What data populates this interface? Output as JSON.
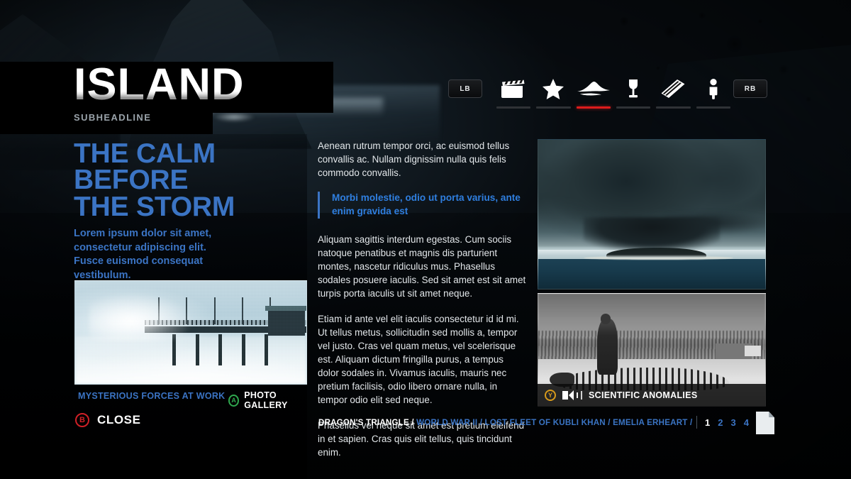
{
  "header": {
    "title": "ISLAND",
    "subheadline": "SUBHEADLINE"
  },
  "topnav": {
    "left_bumper": "LB",
    "right_bumper": "RB",
    "items": [
      {
        "label": "Movies",
        "icon": "clapperboard-icon",
        "active": false
      },
      {
        "label": "Favorites",
        "icon": "star-icon",
        "active": false
      },
      {
        "label": "Island",
        "icon": "island-icon",
        "active": true
      },
      {
        "label": "Goblet",
        "icon": "goblet-icon",
        "active": false
      },
      {
        "label": "Book",
        "icon": "book-icon",
        "active": false
      },
      {
        "label": "Character",
        "icon": "person-icon",
        "active": false
      }
    ],
    "active_indicator_color": "#dd1c1c"
  },
  "feature": {
    "kicker_line1": "THE CALM",
    "kicker_line2": "BEFORE",
    "kicker_line3": "THE STORM",
    "lede": "Lorem ipsum dolor sit amet, consectetur adipiscing elit. Fusce euismod consequat vestibulum.",
    "photo_caption": "MYSTERIOUS FORCES AT WORK",
    "gallery_button": "PHOTO GALLERY",
    "gallery_button_glyph": "A",
    "close_button": "CLOSE",
    "close_button_glyph": "B"
  },
  "article": {
    "p1": "Aenean rutrum tempor orci, ac euismod tellus convallis ac. Nullam dignissim nulla quis felis commodo convallis.",
    "pullquote": "Morbi molestie, odio ut porta varius, ante enim gravida est",
    "p2": "Aliquam sagittis interdum egestas. Cum sociis natoque penatibus et magnis dis parturient montes, nascetur ridiculus mus. Phasellus sodales posuere iaculis. Sed sit amet est sit amet turpis porta iaculis ut sit amet neque.",
    "p3": "Etiam id ante vel elit iaculis consectetur id id mi. Ut tellus metus, sollicitudin sed mollis a, tempor vel justo. Cras vel quam metus, vel scelerisque est. Aliquam dictum fringilla purus, a tempus dolor sodales in. Vivamus iaculis, mauris nec pretium facilisis, odio libero ornare nulla, in tempor odio elit sed neque.",
    "p4": "Phasellus vel neque sit amet est pretium eleifend in et sapien. Cras quis elit tellus, quis tincidunt enim."
  },
  "media": {
    "storm_alt": "Supercell storm cloud over small island",
    "bw_alt": "Man standing beside large animal skeleton",
    "bw_caption": "SCIENTIFIC ANOMALIES",
    "bw_caption_glyph": "Y"
  },
  "footer": {
    "breadcrumb_current": "DRAGON'S TRIANGLE /",
    "breadcrumb_links": "WORLD WAR II / LOST FLEET OF KUBLI KHAN / EMELIA ERHEART /",
    "pages": [
      "1",
      "2",
      "3",
      "4"
    ],
    "active_page": "1"
  },
  "colors": {
    "accent_blue": "#3b74c4",
    "active_red": "#dd1c1c",
    "button_a_green": "#2fa84f",
    "button_b_red": "#cf2027",
    "button_y_yellow": "#d79a1b"
  }
}
